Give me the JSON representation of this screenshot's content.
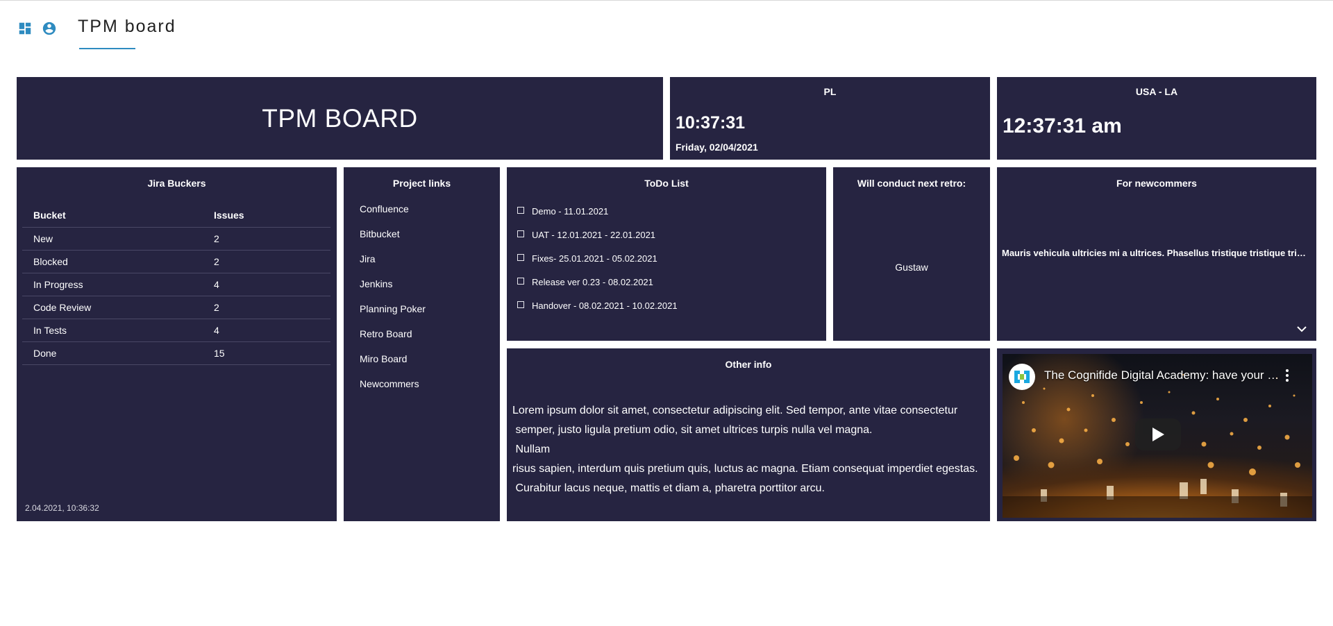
{
  "header": {
    "title": "TPM board",
    "icons": [
      "dashboard-icon",
      "account-circle-icon"
    ],
    "accent": "#2e8bc0"
  },
  "board": {
    "title": "TPM BOARD",
    "background": "#262441"
  },
  "clock_pl": {
    "label": "PL",
    "time": "10:37:31",
    "date": "Friday, 02/04/2021"
  },
  "clock_usa": {
    "label": "USA - LA",
    "time": "12:37:31 am"
  },
  "jira": {
    "title": "Jira Buckers",
    "headers": [
      "Bucket",
      "Issues"
    ],
    "rows": [
      {
        "bucket": "New",
        "issues": "2"
      },
      {
        "bucket": "Blocked",
        "issues": "2"
      },
      {
        "bucket": "In Progress",
        "issues": "4"
      },
      {
        "bucket": "Code Review",
        "issues": "2"
      },
      {
        "bucket": "In Tests",
        "issues": "4"
      },
      {
        "bucket": "Done",
        "issues": "15"
      }
    ],
    "timestamp": "2.04.2021, 10:36:32"
  },
  "links": {
    "title": "Project links",
    "items": [
      "Confluence",
      "Bitbucket",
      "Jira",
      "Jenkins",
      "Planning Poker",
      "Retro Board",
      "Miro Board",
      "Newcommers"
    ]
  },
  "todo": {
    "title": "ToDo List",
    "items": [
      "Demo - 11.01.2021",
      "UAT - 12.01.2021 - 22.01.2021",
      "Fixes- 25.01.2021 - 05.02.2021",
      "Release ver 0.23 - 08.02.2021",
      "Handover - 08.02.2021 - 10.02.2021"
    ]
  },
  "retro": {
    "title": "Will conduct next retro:",
    "name": "Gustaw"
  },
  "newcomers": {
    "title": "For newcommers",
    "text": "Mauris vehicula ultricies mi a ultrices. Phasellus tristique tristique tristique."
  },
  "other": {
    "title": "Other info",
    "lines": [
      "Lorem ipsum dolor sit amet, consectetur adipiscing elit. Sed tempor, ante vitae consectetur",
      " semper, justo ligula pretium odio, sit amet ultrices turpis nulla vel magna.",
      " Nullam",
      "risus sapien, interdum quis pretium quis, luctus ac magna. Etiam consequat imperdiet egestas.",
      " Curabitur lacus neque, mattis et diam a, pharetra porttitor arcu."
    ]
  },
  "video": {
    "title": "The Cognifide Digital Academy: have your say"
  }
}
